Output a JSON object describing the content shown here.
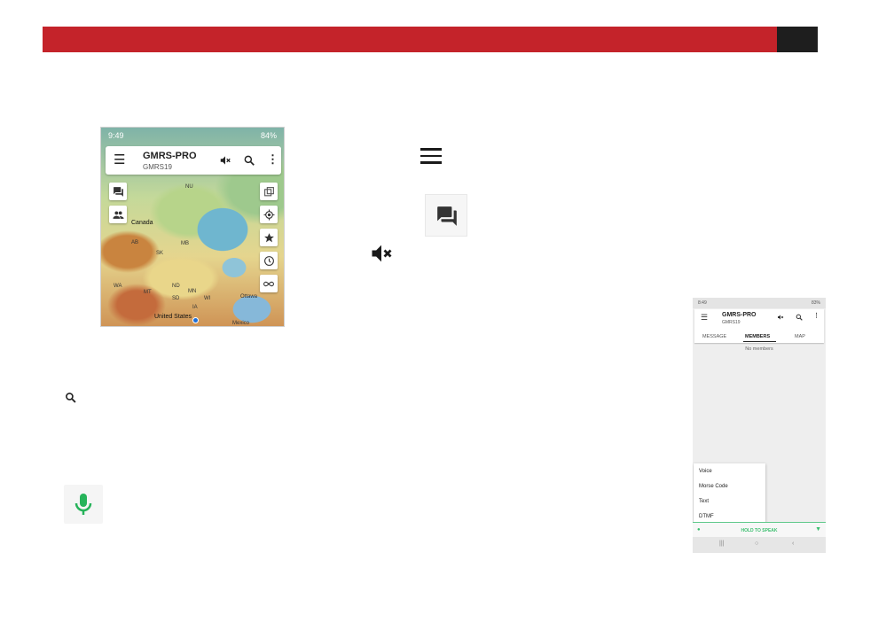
{
  "colors": {
    "banner": "#c4232a",
    "banner_end": "#1e1e1e",
    "accent_green": "#3cbf6f"
  },
  "map_screen": {
    "status_time": "9:49",
    "status_right": "84%",
    "app_title": "GMRS-PRO",
    "channel": "GMRS19",
    "labels": {
      "canada": "Canada",
      "united_states": "United States",
      "nu": "NU",
      "ab": "AB",
      "sk": "SK",
      "mb": "MB",
      "nd": "ND",
      "wa": "WA",
      "mt": "MT",
      "sd": "SD",
      "mn": "MN",
      "wi": "WI",
      "ia": "IA",
      "ottawa": "Ottawa",
      "mexico": "Mexico"
    },
    "icons": [
      "menu-icon",
      "mute-icon",
      "search-icon",
      "more-vert-icon",
      "chat-icon",
      "people-icon",
      "layers-icon",
      "locate-icon",
      "star-icon",
      "history-icon",
      "infinity-icon"
    ]
  },
  "phone_screen": {
    "status_time": "8:49",
    "status_right": "83%",
    "app_title": "GMRS-PRO",
    "channel": "GMRS19",
    "tabs": [
      "MESSAGE",
      "MEMBERS",
      "MAP"
    ],
    "active_tab": "MEMBERS",
    "empty_text": "No members",
    "menu_items": [
      "Voice",
      "Morse Code",
      "Text",
      "DTMF"
    ],
    "ptt_label": "HOLD TO SPEAK"
  }
}
